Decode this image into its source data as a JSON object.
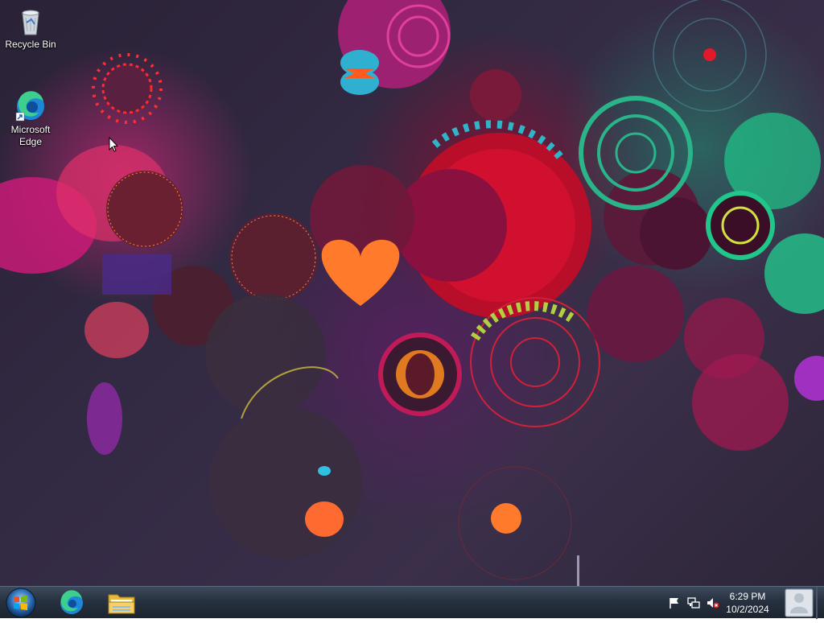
{
  "desktop": {
    "icons": [
      {
        "label": "Recycle Bin",
        "icon": "recycle-bin-icon"
      },
      {
        "label": "Microsoft Edge",
        "icon": "edge-icon"
      }
    ]
  },
  "taskbar": {
    "start_icon": "windows-start-icon",
    "pinned": [
      {
        "name": "Microsoft Edge",
        "icon": "edge-icon"
      },
      {
        "name": "File Explorer",
        "icon": "folder-icon"
      }
    ],
    "tray": {
      "icons": [
        "flag-icon",
        "network-icon",
        "volume-muted-icon"
      ],
      "time": "6:29 PM",
      "date": "10/2/2024"
    }
  }
}
